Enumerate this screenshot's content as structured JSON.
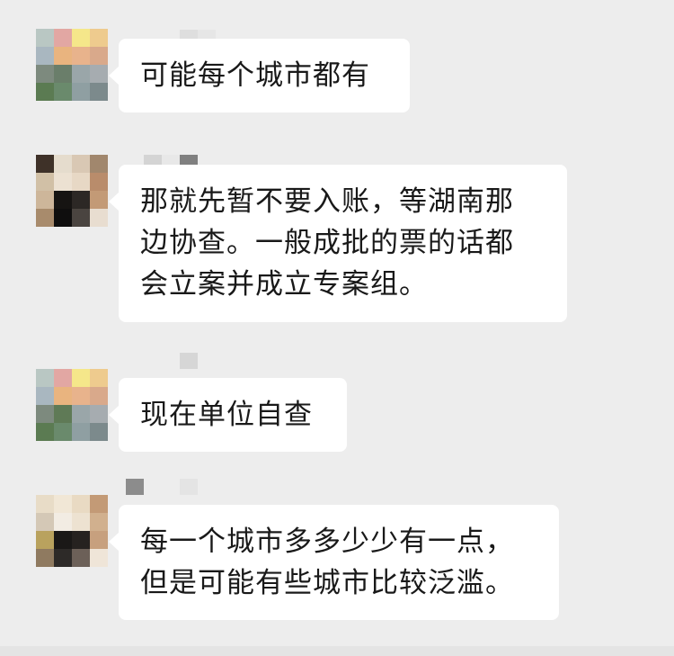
{
  "messages": [
    {
      "sender": "contact-1",
      "lines": [
        "可能每个城市都有"
      ]
    },
    {
      "sender": "contact-2",
      "lines": [
        "那就先暂不要入账，等湖南那",
        "边协查。一般成批的票的话都",
        "会立案并成立专案组。"
      ]
    },
    {
      "sender": "contact-1",
      "lines": [
        "现在单位自查"
      ]
    },
    {
      "sender": "contact-3",
      "lines": [
        "每一个城市多多少少有一点，",
        "但是可能有些城市比较泛滥。"
      ]
    }
  ],
  "colors": {
    "background": "#ededed",
    "bubble": "#ffffff",
    "text": "#191919"
  }
}
